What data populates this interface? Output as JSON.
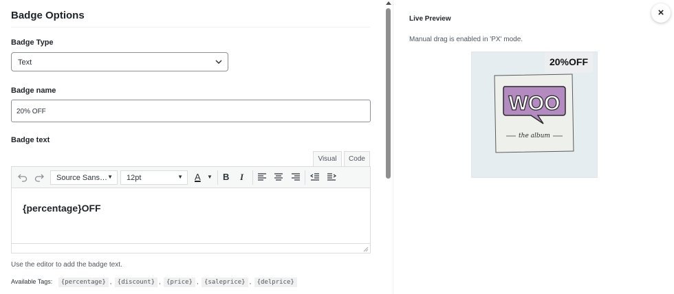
{
  "left": {
    "title": "Badge Options",
    "badge_type": {
      "label": "Badge Type",
      "value": "Text"
    },
    "badge_name": {
      "label": "Badge name",
      "value": "20% OFF"
    },
    "badge_text": {
      "label": "Badge text",
      "tabs": {
        "visual": "Visual",
        "code": "Code"
      },
      "toolbar": {
        "font_family": "Source Sans…",
        "font_size": "12pt",
        "text_color_letter": "A",
        "bold": "B",
        "italic": "I"
      },
      "content": "{percentage}OFF"
    },
    "help": "Use the editor to add the badge text.",
    "tags": {
      "label": "Available Tags:",
      "items": [
        "{percentage}",
        "{discount}",
        "{price}",
        "{saleprice}",
        "{delprice}"
      ],
      "separator": ","
    }
  },
  "right": {
    "title": "Live Preview",
    "note": "Manual drag is enabled in 'PX' mode.",
    "badge": "20%OFF",
    "album": {
      "logo": "WOO",
      "caption": "the album"
    }
  },
  "close_label": "×",
  "icons": [
    "undo-icon",
    "redo-icon",
    "chevron-down-icon",
    "align-left-icon",
    "align-center-icon",
    "align-right-icon",
    "outdent-icon",
    "indent-icon",
    "resize-handle-icon",
    "close-icon"
  ],
  "colors": {
    "accent": "#2271b1",
    "album_purple": "#b48bc1",
    "border": "#8c8f94"
  }
}
